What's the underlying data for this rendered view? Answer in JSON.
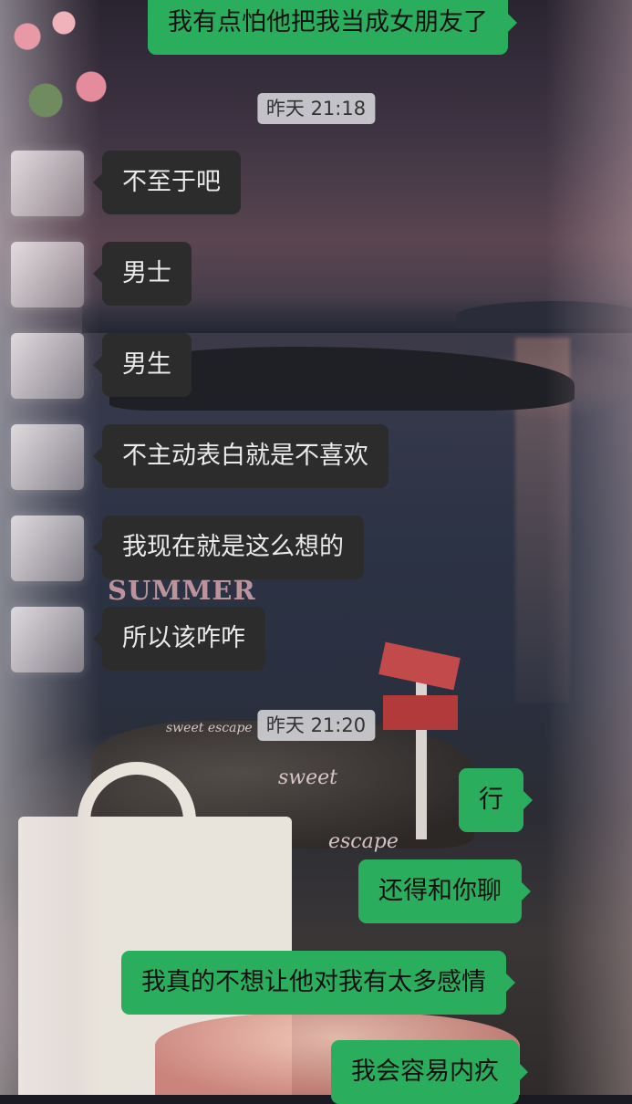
{
  "chat": {
    "messages": [
      {
        "side": "sent",
        "text": "我有点怕他把我当成女朋友了"
      },
      {
        "type": "time",
        "text": "昨天 21:18"
      },
      {
        "side": "recv",
        "text": "不至于吧"
      },
      {
        "side": "recv",
        "text": "男士"
      },
      {
        "side": "recv",
        "text": "男生"
      },
      {
        "side": "recv",
        "text": "不主动表白就是不喜欢"
      },
      {
        "side": "recv",
        "text": "我现在就是这么想的"
      },
      {
        "side": "recv",
        "text": "所以该咋咋"
      },
      {
        "type": "time",
        "text": "昨天 21:20"
      },
      {
        "side": "sent",
        "text": "行"
      },
      {
        "side": "sent",
        "text": "还得和你聊"
      },
      {
        "side": "sent",
        "text": "我真的不想让他对我有太多感情"
      },
      {
        "side": "sent",
        "text": "我会容易内疚"
      }
    ]
  },
  "wallpaper": {
    "texts": [
      "SUMMER",
      "sweet escape",
      "sweet",
      "escape"
    ]
  },
  "colors": {
    "sent_bubble": "#2aae5e",
    "recv_bubble": "#2c2c2c",
    "timestamp_bg": "#dcdce1"
  }
}
